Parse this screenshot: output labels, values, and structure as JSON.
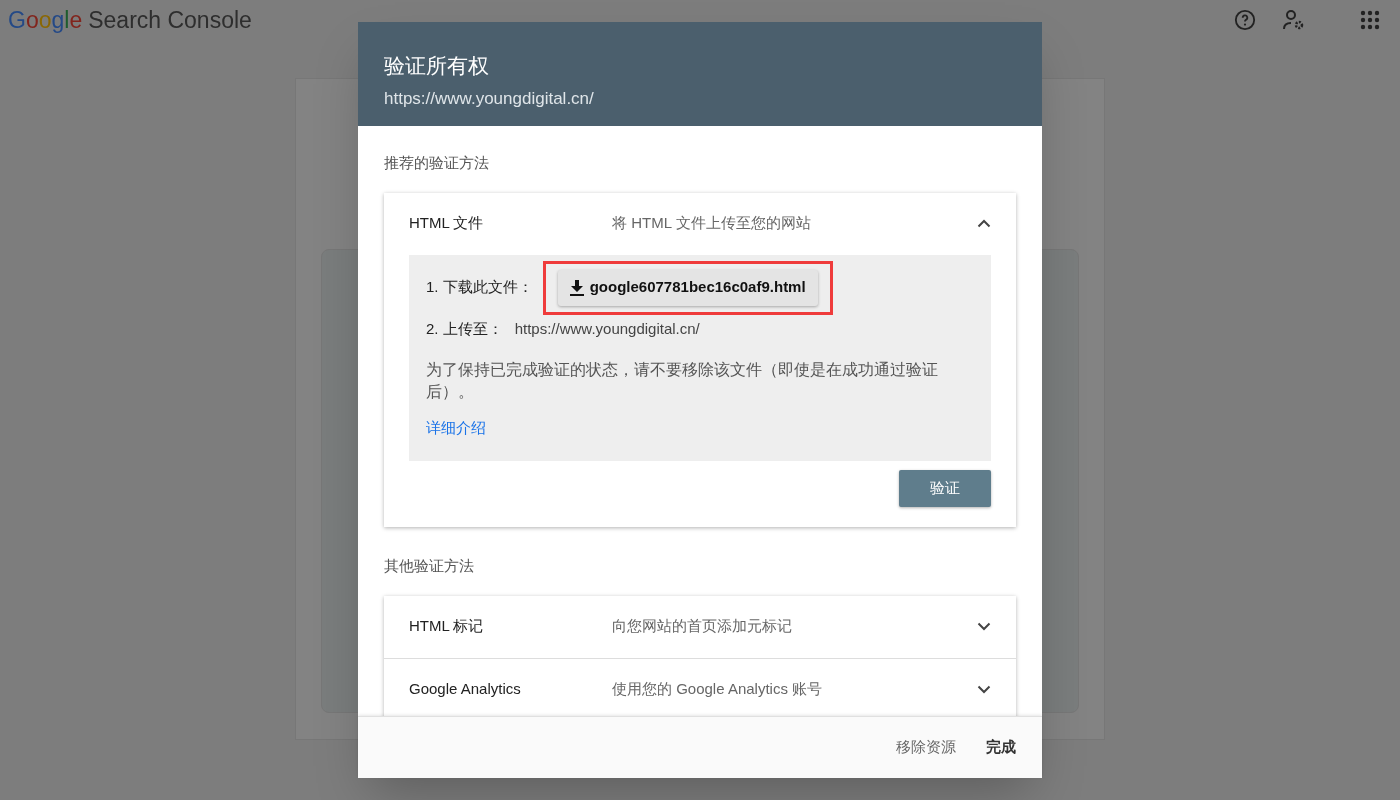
{
  "app": {
    "logo": "Google",
    "product": "Search Console"
  },
  "dialog": {
    "title": "验证所有权",
    "url": "https://www.youngdigital.cn/",
    "recommended_label": "推荐的验证方法",
    "recommended_method": {
      "name": "HTML 文件",
      "description": "将 HTML 文件上传至您的网站",
      "expanded": true,
      "steps": [
        {
          "label": "1. 下载此文件：",
          "kind": "download",
          "value": "google607781bec16c0af9.html",
          "highlighted": true
        },
        {
          "label": "2. 上传至：",
          "kind": "text",
          "value": "https://www.youngdigital.cn/"
        }
      ],
      "note": "为了保持已完成验证的状态，请不要移除该文件（即使是在成功通过验证后）。",
      "link": "详细介绍",
      "verify_button": "验证"
    },
    "other_label": "其他验证方法",
    "other_methods": [
      {
        "name": "HTML 标记",
        "description": "向您网站的首页添加元标记",
        "expanded": false
      },
      {
        "name": "Google Analytics",
        "description": "使用您的 Google Analytics 账号",
        "expanded": false
      }
    ],
    "footer_buttons": [
      {
        "label": "移除资源",
        "kind": "secondary"
      },
      {
        "label": "完成",
        "kind": "primary"
      }
    ]
  }
}
